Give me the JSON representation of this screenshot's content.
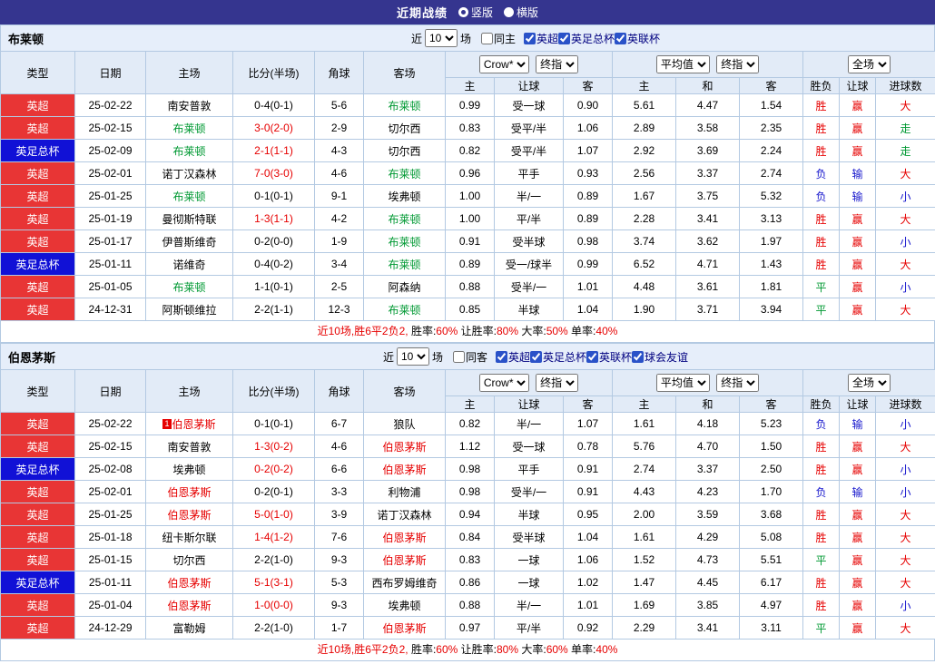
{
  "palette": {
    "topbar_bg": "#35358f",
    "band_bg": "#e6eefa",
    "header_bg": "#e2ebf7",
    "grid_border": "#b3c9e2",
    "league_red_bg": "#e83535",
    "league_blue_bg": "#1111d6",
    "win_red": "#e60000",
    "lose_blue": "#1515cc",
    "draw_green": "#009933",
    "team_green": "#009933",
    "team_red": "#e60000"
  },
  "topbar": {
    "title": "近期战绩",
    "radios": [
      {
        "label": "竖版",
        "selected": true
      },
      {
        "label": "横版",
        "selected": false
      }
    ]
  },
  "sections": [
    {
      "team": "布莱顿",
      "controls": {
        "near_label": "近",
        "matches_count": "10",
        "matches_label": "场",
        "same_venue": {
          "label": "同主",
          "checked": false
        },
        "leagues": [
          {
            "label": "英超",
            "checked": true
          },
          {
            "label": "英足总杯",
            "checked": true
          },
          {
            "label": "英联杯",
            "checked": true
          }
        ]
      },
      "header": {
        "cols": [
          "类型",
          "日期",
          "主场",
          "比分(半场)",
          "角球",
          "客场"
        ],
        "company_select": "Crow*",
        "final_select1": "终指",
        "avg_select": "平均值",
        "final_select2": "终指",
        "scope_select": "全场",
        "sub_cols": [
          "主",
          "让球",
          "客",
          "主",
          "和",
          "客",
          "胜负",
          "让球",
          "进球数"
        ]
      },
      "rows": [
        {
          "type": "英超",
          "type_bg": "#e83535",
          "date": "25-02-22",
          "home": "南安普敦",
          "score": "0-4(0-1)",
          "corner": "5-6",
          "away": "布莱顿",
          "away_c": "#009933",
          "o1": "0.99",
          "handicap": "受一球",
          "o2": "0.90",
          "a1": "5.61",
          "a2": "4.47",
          "a3": "1.54",
          "r1": "胜",
          "r1_c": "#e60000",
          "r2": "赢",
          "r2_c": "#e60000",
          "r3": "大",
          "r3_c": "#e60000"
        },
        {
          "type": "英超",
          "type_bg": "#e83535",
          "date": "25-02-15",
          "home": "布莱顿",
          "home_c": "#009933",
          "score": "3-0(2-0)",
          "score_c": "#e60000",
          "corner": "2-9",
          "away": "切尔西",
          "o1": "0.83",
          "handicap": "受平/半",
          "o2": "1.06",
          "a1": "2.89",
          "a2": "3.58",
          "a3": "2.35",
          "r1": "胜",
          "r1_c": "#e60000",
          "r2": "赢",
          "r2_c": "#e60000",
          "r3": "走",
          "r3_c": "#009933"
        },
        {
          "type": "英足总杯",
          "type_bg": "#1111d6",
          "date": "25-02-09",
          "home": "布莱顿",
          "home_c": "#009933",
          "score": "2-1(1-1)",
          "score_c": "#e60000",
          "corner": "4-3",
          "away": "切尔西",
          "o1": "0.82",
          "handicap": "受平/半",
          "o2": "1.07",
          "a1": "2.92",
          "a2": "3.69",
          "a3": "2.24",
          "r1": "胜",
          "r1_c": "#e60000",
          "r2": "赢",
          "r2_c": "#e60000",
          "r3": "走",
          "r3_c": "#009933"
        },
        {
          "type": "英超",
          "type_bg": "#e83535",
          "date": "25-02-01",
          "home": "诺丁汉森林",
          "score": "7-0(3-0)",
          "score_c": "#e60000",
          "corner": "4-6",
          "away": "布莱顿",
          "away_c": "#009933",
          "o1": "0.96",
          "handicap": "平手",
          "o2": "0.93",
          "a1": "2.56",
          "a2": "3.37",
          "a3": "2.74",
          "r1": "负",
          "r1_c": "#1515cc",
          "r2": "输",
          "r2_c": "#1515cc",
          "r3": "大",
          "r3_c": "#e60000"
        },
        {
          "type": "英超",
          "type_bg": "#e83535",
          "date": "25-01-25",
          "home": "布莱顿",
          "home_c": "#009933",
          "score": "0-1(0-1)",
          "corner": "9-1",
          "away": "埃弗顿",
          "o1": "1.00",
          "handicap": "半/一",
          "o2": "0.89",
          "a1": "1.67",
          "a2": "3.75",
          "a3": "5.32",
          "r1": "负",
          "r1_c": "#1515cc",
          "r2": "输",
          "r2_c": "#1515cc",
          "r3": "小",
          "r3_c": "#1515cc"
        },
        {
          "type": "英超",
          "type_bg": "#e83535",
          "date": "25-01-19",
          "home": "曼彻斯特联",
          "score": "1-3(1-1)",
          "score_c": "#e60000",
          "corner": "4-2",
          "away": "布莱顿",
          "away_c": "#009933",
          "o1": "1.00",
          "handicap": "平/半",
          "o2": "0.89",
          "a1": "2.28",
          "a2": "3.41",
          "a3": "3.13",
          "r1": "胜",
          "r1_c": "#e60000",
          "r2": "赢",
          "r2_c": "#e60000",
          "r3": "大",
          "r3_c": "#e60000"
        },
        {
          "type": "英超",
          "type_bg": "#e83535",
          "date": "25-01-17",
          "home": "伊普斯维奇",
          "score": "0-2(0-0)",
          "corner": "1-9",
          "away": "布莱顿",
          "away_c": "#009933",
          "o1": "0.91",
          "handicap": "受半球",
          "o2": "0.98",
          "a1": "3.74",
          "a2": "3.62",
          "a3": "1.97",
          "r1": "胜",
          "r1_c": "#e60000",
          "r2": "赢",
          "r2_c": "#e60000",
          "r3": "小",
          "r3_c": "#1515cc"
        },
        {
          "type": "英足总杯",
          "type_bg": "#1111d6",
          "date": "25-01-11",
          "home": "诺维奇",
          "score": "0-4(0-2)",
          "corner": "3-4",
          "away": "布莱顿",
          "away_c": "#009933",
          "o1": "0.89",
          "handicap": "受一/球半",
          "o2": "0.99",
          "a1": "6.52",
          "a2": "4.71",
          "a3": "1.43",
          "r1": "胜",
          "r1_c": "#e60000",
          "r2": "赢",
          "r2_c": "#e60000",
          "r3": "大",
          "r3_c": "#e60000"
        },
        {
          "type": "英超",
          "type_bg": "#e83535",
          "date": "25-01-05",
          "home": "布莱顿",
          "home_c": "#009933",
          "score": "1-1(0-1)",
          "corner": "2-5",
          "away": "阿森纳",
          "o1": "0.88",
          "handicap": "受半/一",
          "o2": "1.01",
          "a1": "4.48",
          "a2": "3.61",
          "a3": "1.81",
          "r1": "平",
          "r1_c": "#009933",
          "r2": "赢",
          "r2_c": "#e60000",
          "r3": "小",
          "r3_c": "#1515cc"
        },
        {
          "type": "英超",
          "type_bg": "#e83535",
          "date": "24-12-31",
          "home": "阿斯顿维拉",
          "score": "2-2(1-1)",
          "corner": "12-3",
          "away": "布莱顿",
          "away_c": "#009933",
          "o1": "0.85",
          "handicap": "半球",
          "o2": "1.04",
          "a1": "1.90",
          "a2": "3.71",
          "a3": "3.94",
          "r1": "平",
          "r1_c": "#009933",
          "r2": "赢",
          "r2_c": "#e60000",
          "r3": "大",
          "r3_c": "#e60000"
        }
      ],
      "summary": [
        {
          "t": "近10场,胜6平2负2, ",
          "c": "#e60000"
        },
        {
          "t": "胜率:",
          "c": "#000000"
        },
        {
          "t": "60% ",
          "c": "#e60000"
        },
        {
          "t": "让胜率:",
          "c": "#000000"
        },
        {
          "t": "80% ",
          "c": "#e60000"
        },
        {
          "t": "大率:",
          "c": "#000000"
        },
        {
          "t": "50% ",
          "c": "#e60000"
        },
        {
          "t": "单率:",
          "c": "#000000"
        },
        {
          "t": "40%",
          "c": "#e60000"
        }
      ]
    },
    {
      "team": "伯恩茅斯",
      "controls": {
        "near_label": "近",
        "matches_count": "10",
        "matches_label": "场",
        "same_venue": {
          "label": "同客",
          "checked": false
        },
        "leagues": [
          {
            "label": "英超",
            "checked": true
          },
          {
            "label": "英足总杯",
            "checked": true
          },
          {
            "label": "英联杯",
            "checked": true
          },
          {
            "label": "球会友谊",
            "checked": true
          }
        ]
      },
      "header": {
        "cols": [
          "类型",
          "日期",
          "主场",
          "比分(半场)",
          "角球",
          "客场"
        ],
        "company_select": "Crow*",
        "final_select1": "终指",
        "avg_select": "平均值",
        "final_select2": "终指",
        "scope_select": "全场",
        "sub_cols": [
          "主",
          "让球",
          "客",
          "主",
          "和",
          "客",
          "胜负",
          "让球",
          "进球数"
        ]
      },
      "rows": [
        {
          "type": "英超",
          "type_bg": "#e83535",
          "date": "25-02-22",
          "home": "伯恩茅斯",
          "home_c": "#e60000",
          "badge": "1",
          "score": "0-1(0-1)",
          "corner": "6-7",
          "away": "狼队",
          "o1": "0.82",
          "handicap": "半/一",
          "o2": "1.07",
          "a1": "1.61",
          "a2": "4.18",
          "a3": "5.23",
          "r1": "负",
          "r1_c": "#1515cc",
          "r2": "输",
          "r2_c": "#1515cc",
          "r3": "小",
          "r3_c": "#1515cc"
        },
        {
          "type": "英超",
          "type_bg": "#e83535",
          "date": "25-02-15",
          "home": "南安普敦",
          "score": "1-3(0-2)",
          "score_c": "#e60000",
          "corner": "4-6",
          "away": "伯恩茅斯",
          "away_c": "#e60000",
          "o1": "1.12",
          "handicap": "受一球",
          "o2": "0.78",
          "a1": "5.76",
          "a2": "4.70",
          "a3": "1.50",
          "r1": "胜",
          "r1_c": "#e60000",
          "r2": "赢",
          "r2_c": "#e60000",
          "r3": "大",
          "r3_c": "#e60000"
        },
        {
          "type": "英足总杯",
          "type_bg": "#1111d6",
          "date": "25-02-08",
          "home": "埃弗顿",
          "score": "0-2(0-2)",
          "score_c": "#e60000",
          "corner": "6-6",
          "away": "伯恩茅斯",
          "away_c": "#e60000",
          "o1": "0.98",
          "handicap": "平手",
          "o2": "0.91",
          "a1": "2.74",
          "a2": "3.37",
          "a3": "2.50",
          "r1": "胜",
          "r1_c": "#e60000",
          "r2": "赢",
          "r2_c": "#e60000",
          "r3": "小",
          "r3_c": "#1515cc"
        },
        {
          "type": "英超",
          "type_bg": "#e83535",
          "date": "25-02-01",
          "home": "伯恩茅斯",
          "home_c": "#e60000",
          "score": "0-2(0-1)",
          "corner": "3-3",
          "away": "利物浦",
          "o1": "0.98",
          "handicap": "受半/一",
          "o2": "0.91",
          "a1": "4.43",
          "a2": "4.23",
          "a3": "1.70",
          "r1": "负",
          "r1_c": "#1515cc",
          "r2": "输",
          "r2_c": "#1515cc",
          "r3": "小",
          "r3_c": "#1515cc"
        },
        {
          "type": "英超",
          "type_bg": "#e83535",
          "date": "25-01-25",
          "home": "伯恩茅斯",
          "home_c": "#e60000",
          "score": "5-0(1-0)",
          "score_c": "#e60000",
          "corner": "3-9",
          "away": "诺丁汉森林",
          "o1": "0.94",
          "handicap": "半球",
          "o2": "0.95",
          "a1": "2.00",
          "a2": "3.59",
          "a3": "3.68",
          "r1": "胜",
          "r1_c": "#e60000",
          "r2": "赢",
          "r2_c": "#e60000",
          "r3": "大",
          "r3_c": "#e60000"
        },
        {
          "type": "英超",
          "type_bg": "#e83535",
          "date": "25-01-18",
          "home": "纽卡斯尔联",
          "score": "1-4(1-2)",
          "score_c": "#e60000",
          "corner": "7-6",
          "away": "伯恩茅斯",
          "away_c": "#e60000",
          "o1": "0.84",
          "handicap": "受半球",
          "o2": "1.04",
          "a1": "1.61",
          "a2": "4.29",
          "a3": "5.08",
          "r1": "胜",
          "r1_c": "#e60000",
          "r2": "赢",
          "r2_c": "#e60000",
          "r3": "大",
          "r3_c": "#e60000"
        },
        {
          "type": "英超",
          "type_bg": "#e83535",
          "date": "25-01-15",
          "home": "切尔西",
          "score": "2-2(1-0)",
          "corner": "9-3",
          "away": "伯恩茅斯",
          "away_c": "#e60000",
          "o1": "0.83",
          "handicap": "一球",
          "o2": "1.06",
          "a1": "1.52",
          "a2": "4.73",
          "a3": "5.51",
          "r1": "平",
          "r1_c": "#009933",
          "r2": "赢",
          "r2_c": "#e60000",
          "r3": "大",
          "r3_c": "#e60000"
        },
        {
          "type": "英足总杯",
          "type_bg": "#1111d6",
          "date": "25-01-11",
          "home": "伯恩茅斯",
          "home_c": "#e60000",
          "score": "5-1(3-1)",
          "score_c": "#e60000",
          "corner": "5-3",
          "away": "西布罗姆维奇",
          "o1": "0.86",
          "handicap": "一球",
          "o2": "1.02",
          "a1": "1.47",
          "a2": "4.45",
          "a3": "6.17",
          "r1": "胜",
          "r1_c": "#e60000",
          "r2": "赢",
          "r2_c": "#e60000",
          "r3": "大",
          "r3_c": "#e60000"
        },
        {
          "type": "英超",
          "type_bg": "#e83535",
          "date": "25-01-04",
          "home": "伯恩茅斯",
          "home_c": "#e60000",
          "score": "1-0(0-0)",
          "score_c": "#e60000",
          "corner": "9-3",
          "away": "埃弗顿",
          "o1": "0.88",
          "handicap": "半/一",
          "o2": "1.01",
          "a1": "1.69",
          "a2": "3.85",
          "a3": "4.97",
          "r1": "胜",
          "r1_c": "#e60000",
          "r2": "赢",
          "r2_c": "#e60000",
          "r3": "小",
          "r3_c": "#1515cc"
        },
        {
          "type": "英超",
          "type_bg": "#e83535",
          "date": "24-12-29",
          "home": "富勒姆",
          "score": "2-2(1-0)",
          "corner": "1-7",
          "away": "伯恩茅斯",
          "away_c": "#e60000",
          "o1": "0.97",
          "handicap": "平/半",
          "o2": "0.92",
          "a1": "2.29",
          "a2": "3.41",
          "a3": "3.11",
          "r1": "平",
          "r1_c": "#009933",
          "r2": "赢",
          "r2_c": "#e60000",
          "r3": "大",
          "r3_c": "#e60000"
        }
      ],
      "summary": [
        {
          "t": "近10场,胜6平2负2, ",
          "c": "#e60000"
        },
        {
          "t": "胜率:",
          "c": "#000000"
        },
        {
          "t": "60% ",
          "c": "#e60000"
        },
        {
          "t": "让胜率:",
          "c": "#000000"
        },
        {
          "t": "80% ",
          "c": "#e60000"
        },
        {
          "t": "大率:",
          "c": "#000000"
        },
        {
          "t": "60% ",
          "c": "#e60000"
        },
        {
          "t": "单率:",
          "c": "#000000"
        },
        {
          "t": "40%",
          "c": "#e60000"
        }
      ]
    }
  ]
}
